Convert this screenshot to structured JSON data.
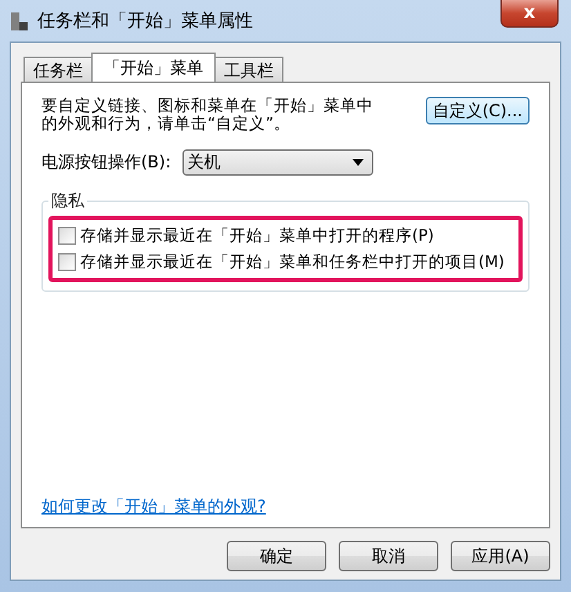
{
  "window": {
    "title": "任务栏和「开始」菜单属性",
    "close": "x"
  },
  "tabs": [
    {
      "label": "任务栏",
      "selected": false
    },
    {
      "label": "「开始」菜单",
      "selected": true
    },
    {
      "label": "工具栏",
      "selected": false
    }
  ],
  "intro": "要自定义链接、图标和菜单在「开始」菜单中的外观和行为，请单击“自定义”。",
  "customize_button": "自定义(C)...",
  "power_button": {
    "label": "电源按钮操作(B):",
    "value": "关机"
  },
  "privacy": {
    "title": "隐私",
    "highlighted": true,
    "options": [
      {
        "label": "存储并显示最近在「开始」菜单中打开的程序(P)",
        "checked": false
      },
      {
        "label": "存储并显示最近在「开始」菜单和任务栏中打开的项目(M)",
        "checked": false
      }
    ]
  },
  "help_link": "如何更改「开始」菜单的外观?",
  "buttons": [
    "确定",
    "取消",
    "应用(A)"
  ]
}
